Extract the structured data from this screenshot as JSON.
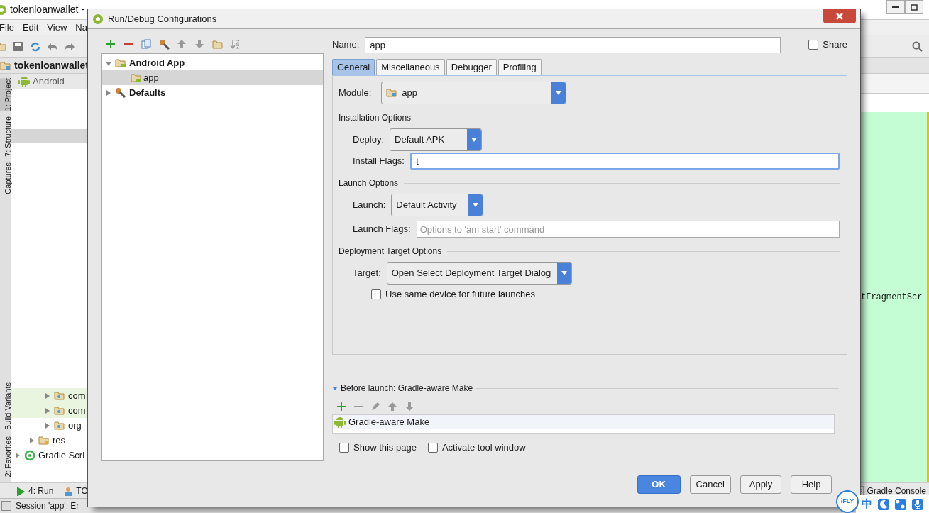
{
  "ide": {
    "title": "tokenloanwallet -",
    "menu": [
      "File",
      "Edit",
      "View",
      "Na"
    ],
    "project_name": "tokenloanwallet",
    "view_selector": "Android",
    "side_tabs": [
      {
        "label": "1: Project",
        "selected": true
      },
      {
        "label": "7: Structure",
        "selected": false
      },
      {
        "label": "Captures",
        "selected": false
      },
      {
        "label": "Build Variants",
        "selected": false
      },
      {
        "label": "2: Favorites",
        "selected": false
      }
    ],
    "tree": [
      {
        "label": "com",
        "kind": "package",
        "highlighted": true
      },
      {
        "label": "com",
        "kind": "package",
        "highlighted": true
      },
      {
        "label": "org",
        "kind": "package",
        "highlighted": false
      },
      {
        "label": "res",
        "kind": "resources",
        "highlighted": false
      },
      {
        "label": "Gradle Scri",
        "kind": "gradle",
        "highlighted": false
      }
    ],
    "bottom_tabs": [
      "4: Run",
      "TO"
    ],
    "editor_text": "tFragmentScr",
    "gradle_console": "Gradle Console",
    "status": "Session 'app': Er"
  },
  "ime": {
    "logo": "iFLY",
    "mode": "中"
  },
  "dialog": {
    "title": "Run/Debug Configurations",
    "config_tree": [
      {
        "label": "Android App",
        "expanded": true,
        "selected": false,
        "children": [
          {
            "label": "app",
            "selected": true
          }
        ]
      },
      {
        "label": "Defaults",
        "expanded": false,
        "selected": false
      }
    ],
    "name_label": "Name:",
    "name": "app",
    "share": {
      "label": "Share",
      "checked": false
    },
    "tabs": [
      {
        "label": "General",
        "selected": true
      },
      {
        "label": "Miscellaneous",
        "selected": false
      },
      {
        "label": "Debugger",
        "selected": false
      },
      {
        "label": "Profiling",
        "selected": false
      }
    ],
    "module_label": "Module:",
    "module": "app",
    "installation_header": "Installation Options",
    "deploy_label": "Deploy:",
    "deploy": "Default APK",
    "install_flags_label": "Install Flags:",
    "install_flags": "-t",
    "launch_header": "Launch Options",
    "launch_label": "Launch:",
    "launch": "Default Activity",
    "launch_flags_label": "Launch Flags:",
    "launch_flags_placeholder": "Options to 'am start' command",
    "target_header": "Deployment Target Options",
    "target_label": "Target:",
    "target": "Open Select Deployment Target Dialog",
    "same_device": {
      "label": "Use same device for future launches",
      "checked": false
    },
    "before_launch": {
      "title": "Before launch: Gradle-aware Make",
      "expanded": true,
      "tasks": [
        "Gradle-aware Make"
      ]
    },
    "show_this_page": {
      "label": "Show this page",
      "checked": false
    },
    "activate_tool_window": {
      "label": "Activate tool window",
      "checked": false
    },
    "buttons": [
      {
        "label": "OK",
        "kind": "primary"
      },
      {
        "label": "Cancel",
        "kind": "normal"
      },
      {
        "label": "Apply",
        "kind": "normal"
      },
      {
        "label": "Help",
        "kind": "normal"
      }
    ]
  }
}
